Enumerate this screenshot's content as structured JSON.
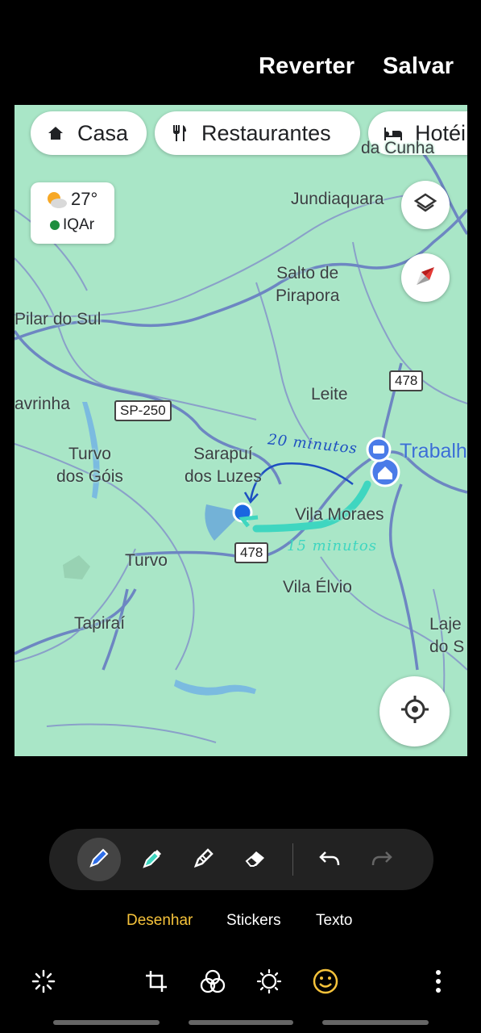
{
  "header": {
    "revert_label": "Reverter",
    "save_label": "Salvar"
  },
  "map": {
    "chips": [
      {
        "label": "Casa",
        "icon": "home-icon"
      },
      {
        "label": "Restaurantes",
        "icon": "restaurant-icon"
      },
      {
        "label": "Hotéi",
        "icon": "hotel-icon"
      }
    ],
    "weather": {
      "temperature": "27°",
      "aqi": "IQAr"
    },
    "places": {
      "da_cunha": "da Cunha",
      "jundiaquara": "Jundiaquara",
      "salto_de_pirapora": "Salto de\nPirapora",
      "pilar_do_sul": "Pilar do Sul",
      "leite": "Leite",
      "avrinha": "avrinha",
      "turvo_dos_gois": "Turvo\ndos Góis",
      "sarapui": "Sarapuí\ndos Luzes",
      "trabalho": "Trabalh",
      "vila_moraes": "Vila Moraes",
      "turvo": "Turvo",
      "vila_elvio": "Vila Élvio",
      "tapirai": "Tapiraí",
      "laje": "Laje\ndo S"
    },
    "road_shields": {
      "sp250": "SP-250",
      "r478_top": "478",
      "r478_bottom": "478"
    },
    "annotations": {
      "blue_note": "20 minutos",
      "teal_note": "15 minutos"
    }
  },
  "editor": {
    "tools": [
      "pen-tool",
      "highlighter-tool",
      "pencil-tool",
      "eraser-tool",
      "undo",
      "redo"
    ],
    "tabs": [
      {
        "label": "Desenhar",
        "active": true
      },
      {
        "label": "Stickers"
      },
      {
        "label": "Texto"
      }
    ],
    "active_color": "#f6c33b",
    "bottom_icons": [
      "auto-enhance-icon",
      "crop-rotate-icon",
      "filters-icon",
      "brightness-icon",
      "decorate-icon",
      "more-icon"
    ]
  }
}
